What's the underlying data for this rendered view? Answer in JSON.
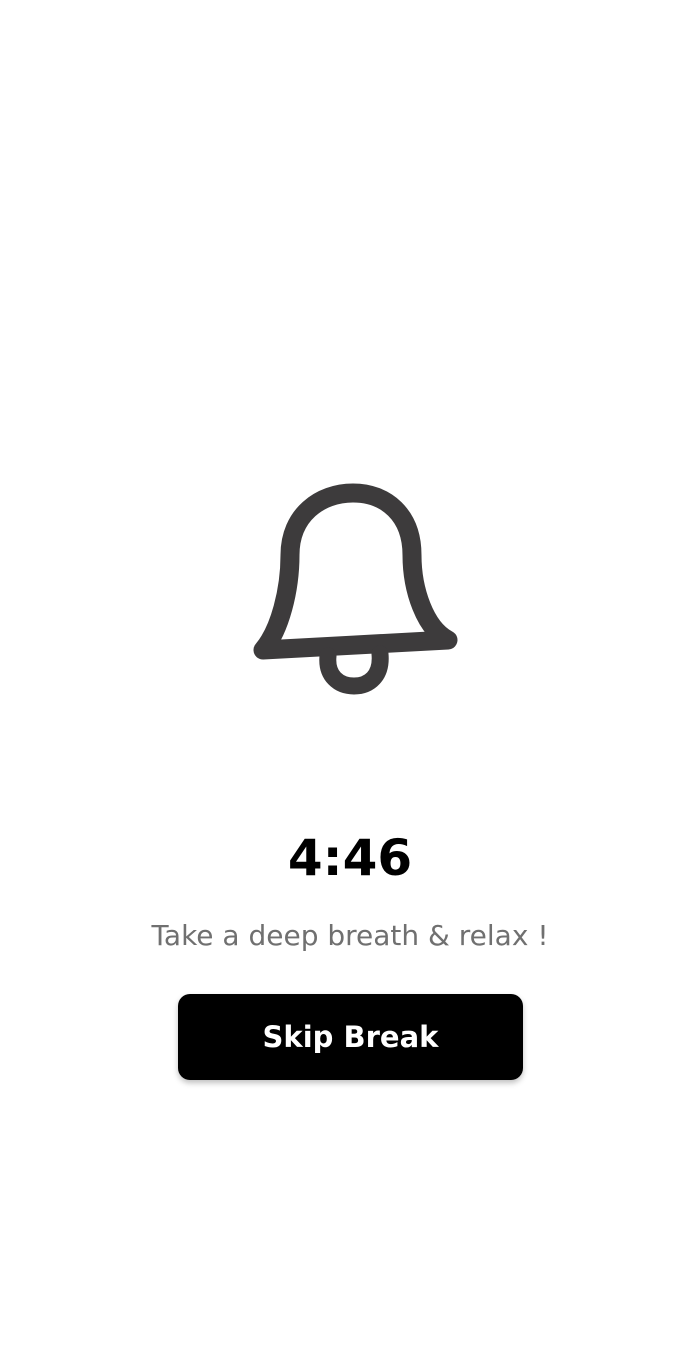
{
  "screen": {
    "icon": "bell-icon",
    "icon_color": "#3d3b3c",
    "timer": "4:46",
    "message": "Take a deep breath & relax !",
    "skip_button_label": "Skip Break",
    "button_color": "#000000",
    "message_color": "#707070"
  }
}
